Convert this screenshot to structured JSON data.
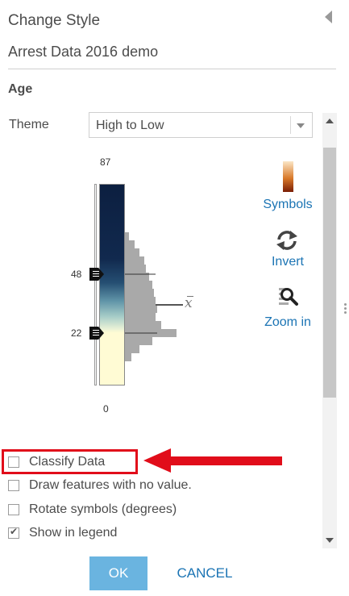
{
  "header": {
    "title": "Change Style",
    "layer_name": "Arrest Data 2016 demo"
  },
  "field": {
    "name": "Age"
  },
  "theme": {
    "label": "Theme",
    "value": "High to Low"
  },
  "slider": {
    "ticks": {
      "max": "87",
      "upper": "48",
      "lower": "22",
      "min": "0"
    },
    "handle_values": [
      48,
      22
    ],
    "mean_symbol": "x"
  },
  "side_actions": {
    "symbols": "Symbols",
    "invert": "Invert",
    "zoom": "Zoom in"
  },
  "options": [
    {
      "label": "Classify Data",
      "checked": false
    },
    {
      "label": "Draw features with no value.",
      "checked": false
    },
    {
      "label": "Rotate symbols (degrees)",
      "checked": false
    },
    {
      "label": "Show in legend",
      "checked": true
    }
  ],
  "buttons": {
    "ok": "OK",
    "cancel": "CANCEL"
  },
  "colors": {
    "accent": "#1b74b4",
    "ok_bg": "#6ab4e0",
    "annotation": "#e10d1a",
    "ramp_high": "#0c1f40",
    "ramp_low": "#fffbd4"
  }
}
